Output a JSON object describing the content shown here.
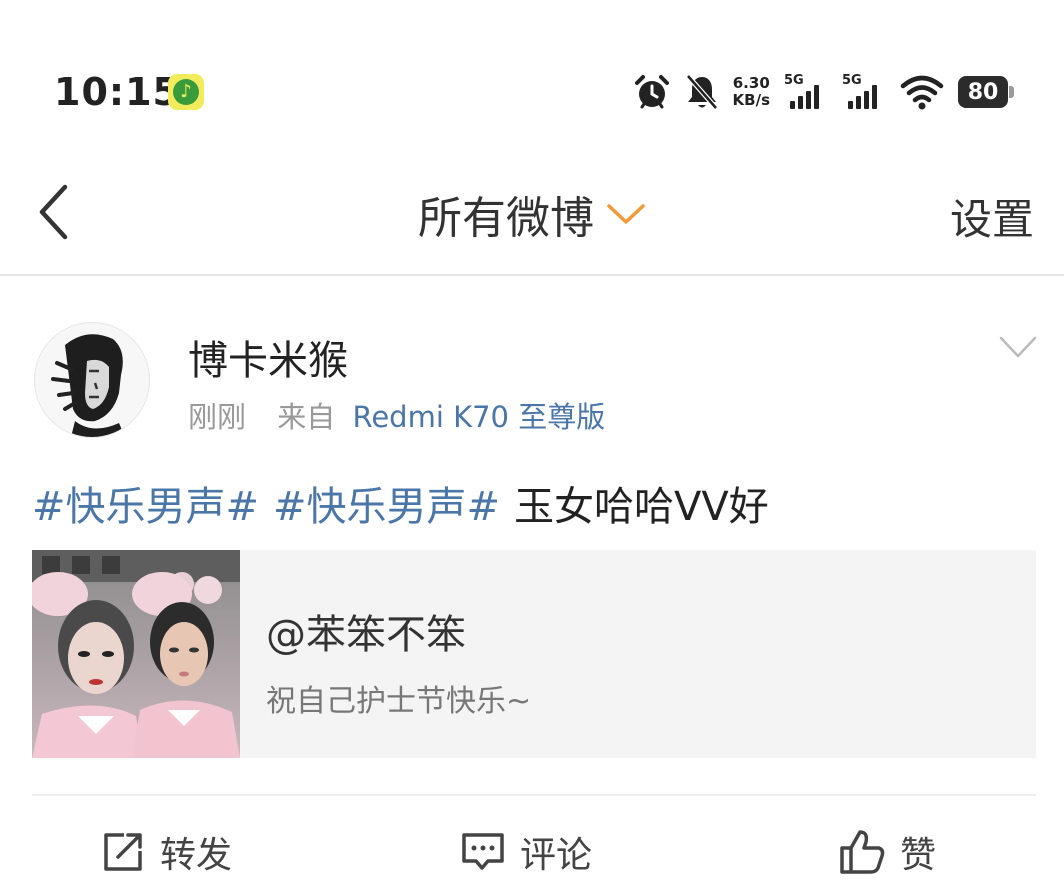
{
  "status_bar": {
    "time": "10:15",
    "music_app_icon": "music-note-icon",
    "net_speed_value": "6.30",
    "net_speed_unit": "KB/s",
    "sim1_label": "5G",
    "sim2_label": "5G",
    "battery": "80"
  },
  "nav": {
    "title": "所有微博",
    "settings_label": "设置",
    "accent_color": "#f29a38"
  },
  "post": {
    "username": "博卡米猴",
    "time": "刚刚",
    "source": "来自",
    "device": "Redmi K70 至尊版",
    "hashtags": [
      "#快乐男声#",
      "#快乐男声#"
    ],
    "text": "玉女哈哈VV好",
    "shared": {
      "title": "@苯笨不笨",
      "description": "祝自己护士节快乐~"
    }
  },
  "actions": {
    "repost": "转发",
    "comment": "评论",
    "like": "赞"
  },
  "colors": {
    "link": "#4a76a8",
    "text": "#222222",
    "muted": "#999999"
  }
}
